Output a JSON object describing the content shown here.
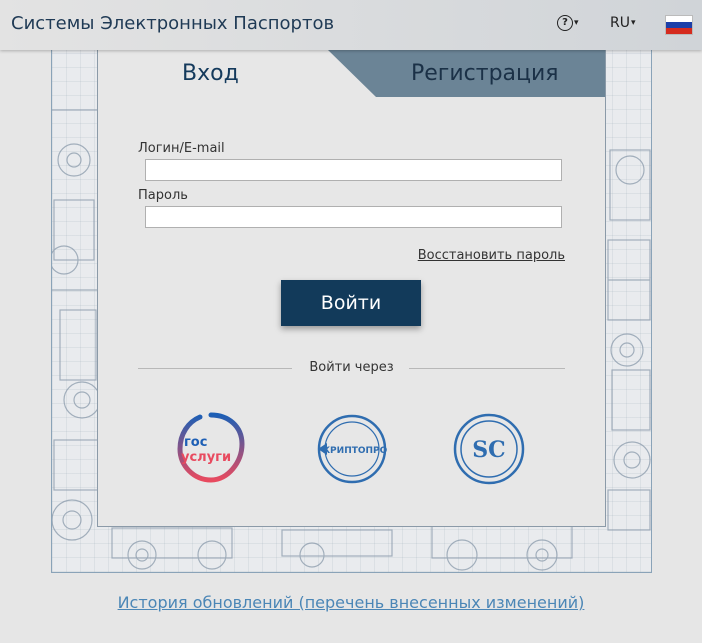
{
  "header": {
    "title": "Системы Электронных Паспортов",
    "help_icon": "question-circle-icon",
    "language": "RU",
    "flag": {
      "name": "russia-flag",
      "colors": [
        "#ffffff",
        "#1c3fa8",
        "#d52b1e"
      ]
    }
  },
  "tabs": {
    "login": "Вход",
    "register": "Регистрация"
  },
  "form": {
    "login_label": "Логин/E-mail",
    "login_value": "",
    "password_label": "Пароль",
    "password_value": "",
    "restore_link": "Восстановить пароль",
    "submit": "Войти"
  },
  "alt_login": {
    "divider": "Войти через",
    "services": [
      {
        "icon": "gosuslugi-logo",
        "line1": "гос",
        "line2": "услуги"
      },
      {
        "icon": "cryptopro-logo",
        "text": "КРИПТОПРО"
      },
      {
        "icon": "sc-logo",
        "text": "SC"
      }
    ]
  },
  "footer": {
    "history_link": "История обновлений (перечень внесенных изменений)"
  },
  "colors": {
    "accent": "#123a5a",
    "tab_inactive": "#6b8496",
    "link": "#4b86b6",
    "gosuslugi_blue": "#1d5fb5",
    "gosuslugi_red": "#e84a5f"
  }
}
